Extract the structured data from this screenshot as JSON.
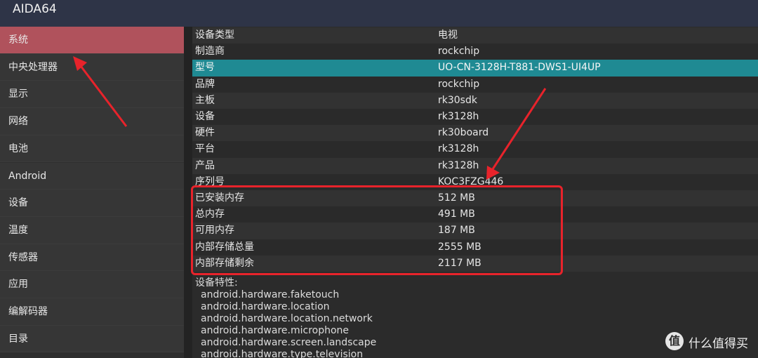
{
  "app": {
    "title": "AIDA64"
  },
  "sidebar": {
    "items": [
      {
        "label": "系统",
        "active": true
      },
      {
        "label": "中央处理器"
      },
      {
        "label": "显示"
      },
      {
        "label": "网络"
      },
      {
        "label": "电池"
      },
      {
        "label": "Android"
      },
      {
        "label": "设备"
      },
      {
        "label": "温度"
      },
      {
        "label": "传感器"
      },
      {
        "label": "应用"
      },
      {
        "label": "编解码器"
      },
      {
        "label": "目录"
      }
    ]
  },
  "system": {
    "rows": [
      {
        "key": "设备类型",
        "value": "电视"
      },
      {
        "key": "制造商",
        "value": "rockchip"
      },
      {
        "key": "型号",
        "value": "UO-CN-3128H-T881-DWS1-UI4UP"
      },
      {
        "key": "品牌",
        "value": "rockchip"
      },
      {
        "key": "主板",
        "value": "rk30sdk"
      },
      {
        "key": "设备",
        "value": "rk3128h"
      },
      {
        "key": "硬件",
        "value": "rk30board"
      },
      {
        "key": "平台",
        "value": "rk3128h"
      },
      {
        "key": "产品",
        "value": "rk3128h"
      },
      {
        "key": "序列号",
        "value": "KOC3FZG446"
      },
      {
        "key": "已安装内存",
        "value": "512 MB"
      },
      {
        "key": "总内存",
        "value": "491 MB"
      },
      {
        "key": "可用内存",
        "value": "187 MB"
      },
      {
        "key": "内部存储总量",
        "value": "2555 MB"
      },
      {
        "key": "内部存储剩余",
        "value": "2117 MB"
      }
    ],
    "features_label": "设备特性:",
    "features": [
      "android.hardware.faketouch",
      "android.hardware.location",
      "android.hardware.location.network",
      "android.hardware.microphone",
      "android.hardware.screen.landscape",
      "android.hardware.type.television"
    ]
  },
  "watermark": {
    "logo": "值",
    "text": "什么值得买"
  },
  "colors": {
    "accent_active": "#b0525c",
    "selected_row": "#1f8a93",
    "annotation": "#e8232b"
  }
}
